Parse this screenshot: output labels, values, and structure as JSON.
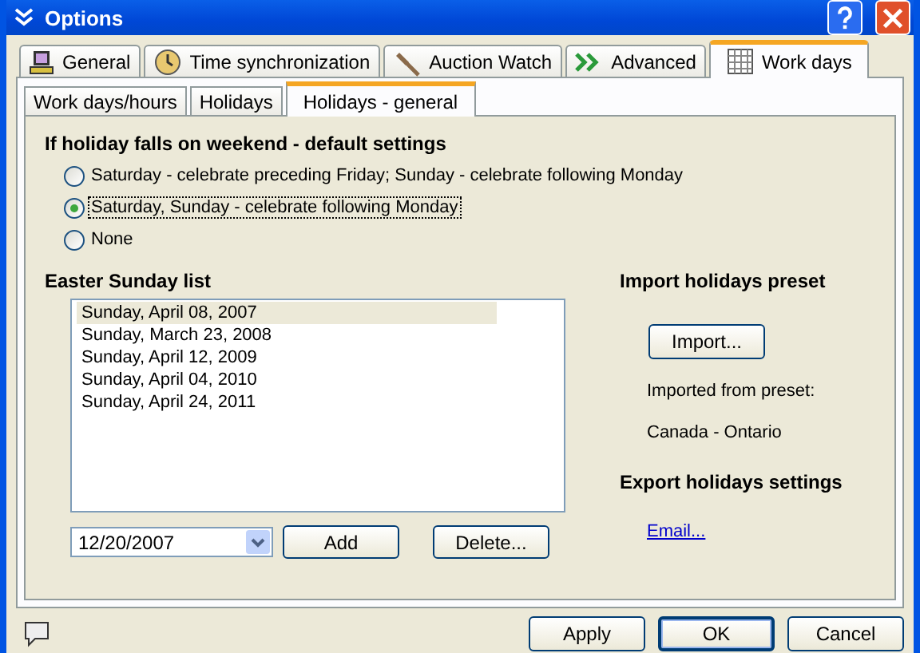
{
  "window": {
    "title": "Options"
  },
  "tabs": [
    {
      "label": "General",
      "selected": false
    },
    {
      "label": "Time synchronization",
      "selected": false
    },
    {
      "label": "Auction Watch",
      "selected": false
    },
    {
      "label": "Advanced",
      "selected": false
    },
    {
      "label": "Work days",
      "selected": true
    }
  ],
  "subtabs": [
    {
      "label": "Work days/hours",
      "selected": false
    },
    {
      "label": "Holidays",
      "selected": false
    },
    {
      "label": "Holidays - general",
      "selected": true
    }
  ],
  "weekend": {
    "heading": "If holiday falls on weekend - default settings",
    "options": [
      {
        "label": "Saturday - celebrate preceding Friday; Sunday - celebrate following Monday",
        "selected": false
      },
      {
        "label": "Saturday, Sunday - celebrate following Monday",
        "selected": true
      },
      {
        "label": "None",
        "selected": false
      }
    ]
  },
  "easter": {
    "heading": "Easter Sunday list",
    "items": [
      {
        "label": "Sunday, April 08, 2007",
        "selected": true
      },
      {
        "label": "Sunday, March 23, 2008",
        "selected": false
      },
      {
        "label": "Sunday, April 12, 2009",
        "selected": false
      },
      {
        "label": "Sunday, April 04, 2010",
        "selected": false
      },
      {
        "label": "Sunday, April 24, 2011",
        "selected": false
      }
    ],
    "date": "12/20/2007",
    "add": "Add",
    "delete": "Delete..."
  },
  "import": {
    "heading": "Import holidays preset",
    "button": "Import...",
    "label": "Imported from preset:",
    "preset": "Canada - Ontario"
  },
  "export": {
    "heading": "Export holidays settings",
    "link": "Email..."
  },
  "footer": [
    "Apply",
    "OK",
    "Cancel"
  ]
}
